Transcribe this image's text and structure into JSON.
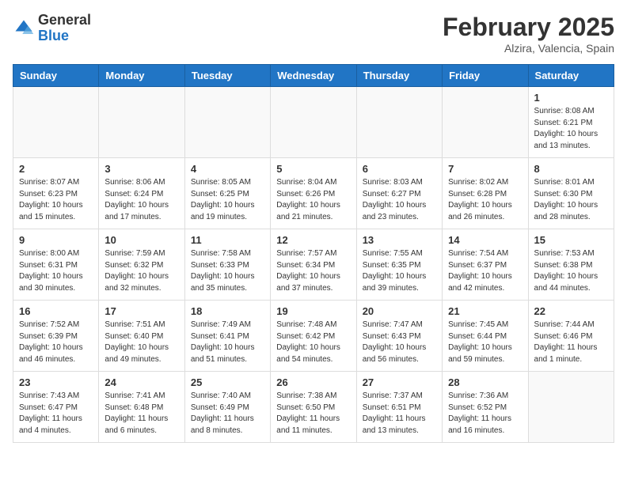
{
  "header": {
    "logo_general": "General",
    "logo_blue": "Blue",
    "month_title": "February 2025",
    "location": "Alzira, Valencia, Spain"
  },
  "days_of_week": [
    "Sunday",
    "Monday",
    "Tuesday",
    "Wednesday",
    "Thursday",
    "Friday",
    "Saturday"
  ],
  "weeks": [
    [
      {
        "day": "",
        "info": ""
      },
      {
        "day": "",
        "info": ""
      },
      {
        "day": "",
        "info": ""
      },
      {
        "day": "",
        "info": ""
      },
      {
        "day": "",
        "info": ""
      },
      {
        "day": "",
        "info": ""
      },
      {
        "day": "1",
        "info": "Sunrise: 8:08 AM\nSunset: 6:21 PM\nDaylight: 10 hours and 13 minutes."
      }
    ],
    [
      {
        "day": "2",
        "info": "Sunrise: 8:07 AM\nSunset: 6:23 PM\nDaylight: 10 hours and 15 minutes."
      },
      {
        "day": "3",
        "info": "Sunrise: 8:06 AM\nSunset: 6:24 PM\nDaylight: 10 hours and 17 minutes."
      },
      {
        "day": "4",
        "info": "Sunrise: 8:05 AM\nSunset: 6:25 PM\nDaylight: 10 hours and 19 minutes."
      },
      {
        "day": "5",
        "info": "Sunrise: 8:04 AM\nSunset: 6:26 PM\nDaylight: 10 hours and 21 minutes."
      },
      {
        "day": "6",
        "info": "Sunrise: 8:03 AM\nSunset: 6:27 PM\nDaylight: 10 hours and 23 minutes."
      },
      {
        "day": "7",
        "info": "Sunrise: 8:02 AM\nSunset: 6:28 PM\nDaylight: 10 hours and 26 minutes."
      },
      {
        "day": "8",
        "info": "Sunrise: 8:01 AM\nSunset: 6:30 PM\nDaylight: 10 hours and 28 minutes."
      }
    ],
    [
      {
        "day": "9",
        "info": "Sunrise: 8:00 AM\nSunset: 6:31 PM\nDaylight: 10 hours and 30 minutes."
      },
      {
        "day": "10",
        "info": "Sunrise: 7:59 AM\nSunset: 6:32 PM\nDaylight: 10 hours and 32 minutes."
      },
      {
        "day": "11",
        "info": "Sunrise: 7:58 AM\nSunset: 6:33 PM\nDaylight: 10 hours and 35 minutes."
      },
      {
        "day": "12",
        "info": "Sunrise: 7:57 AM\nSunset: 6:34 PM\nDaylight: 10 hours and 37 minutes."
      },
      {
        "day": "13",
        "info": "Sunrise: 7:55 AM\nSunset: 6:35 PM\nDaylight: 10 hours and 39 minutes."
      },
      {
        "day": "14",
        "info": "Sunrise: 7:54 AM\nSunset: 6:37 PM\nDaylight: 10 hours and 42 minutes."
      },
      {
        "day": "15",
        "info": "Sunrise: 7:53 AM\nSunset: 6:38 PM\nDaylight: 10 hours and 44 minutes."
      }
    ],
    [
      {
        "day": "16",
        "info": "Sunrise: 7:52 AM\nSunset: 6:39 PM\nDaylight: 10 hours and 46 minutes."
      },
      {
        "day": "17",
        "info": "Sunrise: 7:51 AM\nSunset: 6:40 PM\nDaylight: 10 hours and 49 minutes."
      },
      {
        "day": "18",
        "info": "Sunrise: 7:49 AM\nSunset: 6:41 PM\nDaylight: 10 hours and 51 minutes."
      },
      {
        "day": "19",
        "info": "Sunrise: 7:48 AM\nSunset: 6:42 PM\nDaylight: 10 hours and 54 minutes."
      },
      {
        "day": "20",
        "info": "Sunrise: 7:47 AM\nSunset: 6:43 PM\nDaylight: 10 hours and 56 minutes."
      },
      {
        "day": "21",
        "info": "Sunrise: 7:45 AM\nSunset: 6:44 PM\nDaylight: 10 hours and 59 minutes."
      },
      {
        "day": "22",
        "info": "Sunrise: 7:44 AM\nSunset: 6:46 PM\nDaylight: 11 hours and 1 minute."
      }
    ],
    [
      {
        "day": "23",
        "info": "Sunrise: 7:43 AM\nSunset: 6:47 PM\nDaylight: 11 hours and 4 minutes."
      },
      {
        "day": "24",
        "info": "Sunrise: 7:41 AM\nSunset: 6:48 PM\nDaylight: 11 hours and 6 minutes."
      },
      {
        "day": "25",
        "info": "Sunrise: 7:40 AM\nSunset: 6:49 PM\nDaylight: 11 hours and 8 minutes."
      },
      {
        "day": "26",
        "info": "Sunrise: 7:38 AM\nSunset: 6:50 PM\nDaylight: 11 hours and 11 minutes."
      },
      {
        "day": "27",
        "info": "Sunrise: 7:37 AM\nSunset: 6:51 PM\nDaylight: 11 hours and 13 minutes."
      },
      {
        "day": "28",
        "info": "Sunrise: 7:36 AM\nSunset: 6:52 PM\nDaylight: 11 hours and 16 minutes."
      },
      {
        "day": "",
        "info": ""
      }
    ]
  ]
}
